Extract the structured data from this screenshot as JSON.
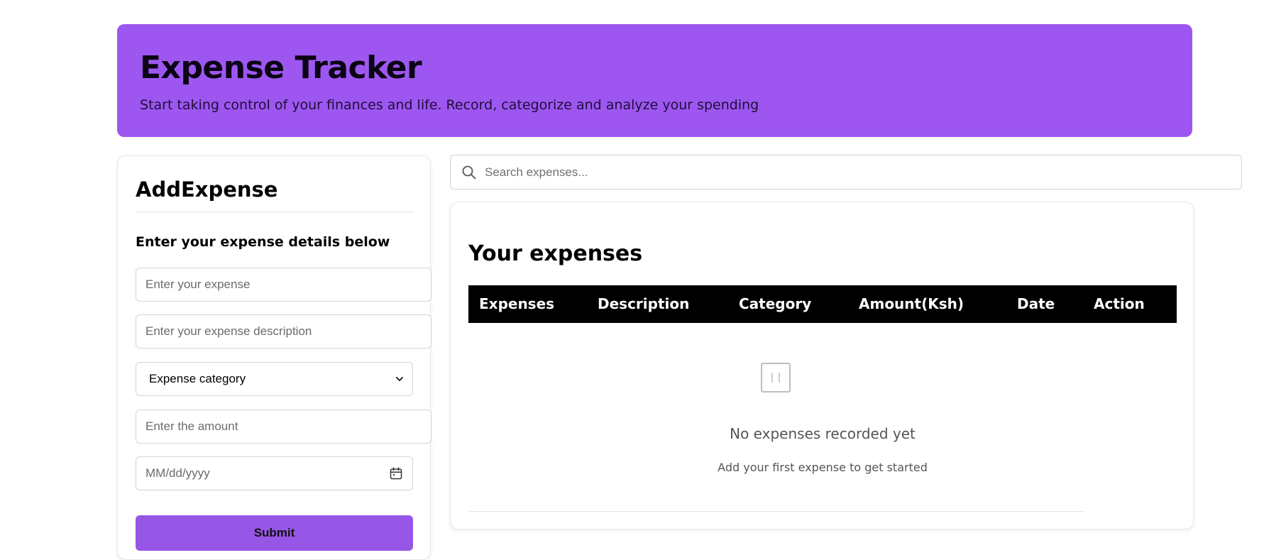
{
  "header": {
    "title": "Expense Tracker",
    "subtitle": "Start taking control of your finances and life. Record, categorize and analyze your spending"
  },
  "add_expense": {
    "title": "AddExpense",
    "subtitle": "Enter your expense details below",
    "expense_placeholder": "Enter your expense",
    "description_placeholder": "Enter your expense description",
    "category_selected": "Expense category",
    "amount_placeholder": "Enter the amount",
    "date_placeholder": "MM/dd/yyyy",
    "submit_label": "Submit"
  },
  "search": {
    "placeholder": "Search expenses..."
  },
  "expenses": {
    "title": "Your expenses",
    "columns": [
      "Expenses",
      "Description",
      "Category",
      "Amount(Ksh)",
      "Date",
      "Action"
    ],
    "empty_title": "No expenses recorded yet",
    "empty_subtitle": "Add your first expense to get started"
  },
  "colors": {
    "header_bg": "#9d57f0",
    "submit_bg": "#9657e6",
    "table_head_bg": "#000000"
  },
  "icons": {
    "search": "search-icon",
    "calendar": "calendar-icon",
    "chevron": "chevron-down-icon",
    "empty": "empty-list-icon"
  }
}
